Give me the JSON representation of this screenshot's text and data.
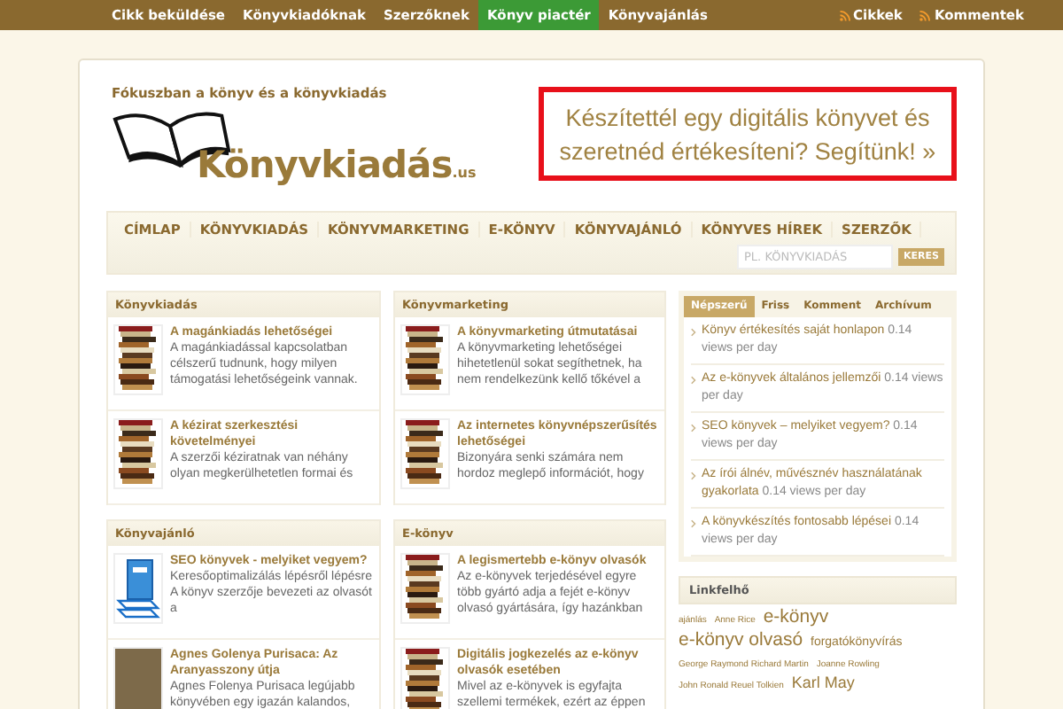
{
  "top_menu": [
    {
      "label": "Cikk beküldése",
      "selected": false
    },
    {
      "label": "Könyvkiadóknak",
      "selected": false
    },
    {
      "label": "Szerzőknek",
      "selected": false
    },
    {
      "label": "Könyv piactér",
      "selected": true
    },
    {
      "label": "Könyvajánlás",
      "selected": false
    }
  ],
  "feeds": [
    "Cikkek",
    "Kommentek"
  ],
  "header": {
    "tagline": "Fókuszban a könyv és a könyvkiadás",
    "logo_text": "Könyvkiadás",
    "logo_suffix": ".us",
    "banner": "Készítettél egy digitális könyvet és szeretnéd értékesíteni? Segítünk! »"
  },
  "main_nav": [
    "CÍMLAP",
    "KÖNYVKIADÁS",
    "KÖNYVMARKETING",
    "E-KÖNYV",
    "KÖNYVAJÁNLÓ",
    "KÖNYVES HÍREK",
    "SZERZŐK"
  ],
  "search": {
    "placeholder": "PL. KÖNYVKIADÁS",
    "button": "KERES"
  },
  "sections": [
    {
      "title": "Könyvkiadás",
      "posts": [
        {
          "kind": "books",
          "title": "A magánkiadás lehetőségei",
          "excerpt": "A magánkiadással kapcsolatban célszerű tudnunk, hogy milyen támogatási lehetőségeink vannak."
        },
        {
          "kind": "books",
          "title": "A kézirat szerkesztési követelményei",
          "excerpt": "A szerzői kéziratnak van néhány olyan megkerülhetetlen formai és"
        }
      ]
    },
    {
      "title": "Könyvmarketing",
      "posts": [
        {
          "kind": "books",
          "title": "A könyvmarketing útmutatásai",
          "excerpt": "A könyvmarketing lehetőségei hihetetlenül sokat segíthetnek, ha nem rendelkezünk kellő tőkével a"
        },
        {
          "kind": "books",
          "title": "Az internetes könyvnépszerűsítés lehetőségei",
          "excerpt": "Bizonyára senki számára nem hordoz meglepő információt, hogy"
        }
      ]
    },
    {
      "title": "Könyvajánló",
      "posts": [
        {
          "kind": "blue-book",
          "title": "SEO könyvek - melyiket vegyem?",
          "excerpt": "Keresőoptimalizálás lépésről lépésre A könyv szerzője bevezeti az olvasót a"
        },
        {
          "kind": "photo",
          "title": "Agnes Golenya Purisaca: Az Aranyasszony útja",
          "excerpt": "Agnes Folenya Purisaca legújabb könyvében egy igazán kalandos,"
        }
      ]
    },
    {
      "title": "E-könyv",
      "posts": [
        {
          "kind": "books",
          "title": "A legismertebb e-könyv olvasók",
          "excerpt": "Az e-könyvek terjedésével egyre több gyártó adja a fejét e-könyv olvasó gyártására, így hazánkban"
        },
        {
          "kind": "books",
          "title": "Digitális jogkezelés az e-könyv olvasók esetében",
          "excerpt": "Mivel az e-könyvek is egyfajta szellemi termékek, ezért az éppen"
        }
      ]
    }
  ],
  "sidebar_tabs": [
    {
      "label": "Népszerű",
      "selected": true
    },
    {
      "label": "Friss",
      "selected": false
    },
    {
      "label": "Komment",
      "selected": false
    },
    {
      "label": "Archívum",
      "selected": false
    }
  ],
  "popular": [
    {
      "title": "Könyv értékesítés saját honlapon",
      "views": "0.14 views per day"
    },
    {
      "title": "Az e-könyvek általános jellemzői",
      "views": "0.14 views per day"
    },
    {
      "title": "SEO könyvek – melyiket vegyem?",
      "views": "0.14 views per day"
    },
    {
      "title": "Az írói álnév, művésznév használatának gyakorlata",
      "views": "0.14 views per day"
    },
    {
      "title": "A könyvkészítés fontosabb lépései",
      "views": "0.14 views per day"
    }
  ],
  "tag_cloud": {
    "title": "Linkfelhő",
    "tags": [
      {
        "label": "ajánlás",
        "kind": "small"
      },
      {
        "label": "Anne Rice",
        "kind": "small"
      },
      {
        "label": "e-könyv",
        "kind": "large"
      },
      {
        "label": "e-könyv olvasó",
        "kind": "large"
      },
      {
        "label": "forgatókönyvírás",
        "kind": "medium"
      },
      {
        "label": "George Raymond Richard Martin",
        "kind": "small"
      },
      {
        "label": "Joanne Rowling",
        "kind": "small"
      },
      {
        "label": "John Ronald Reuel Tolkien",
        "kind": "small"
      },
      {
        "label": "Karl May",
        "kind": "mlarge"
      }
    ]
  }
}
